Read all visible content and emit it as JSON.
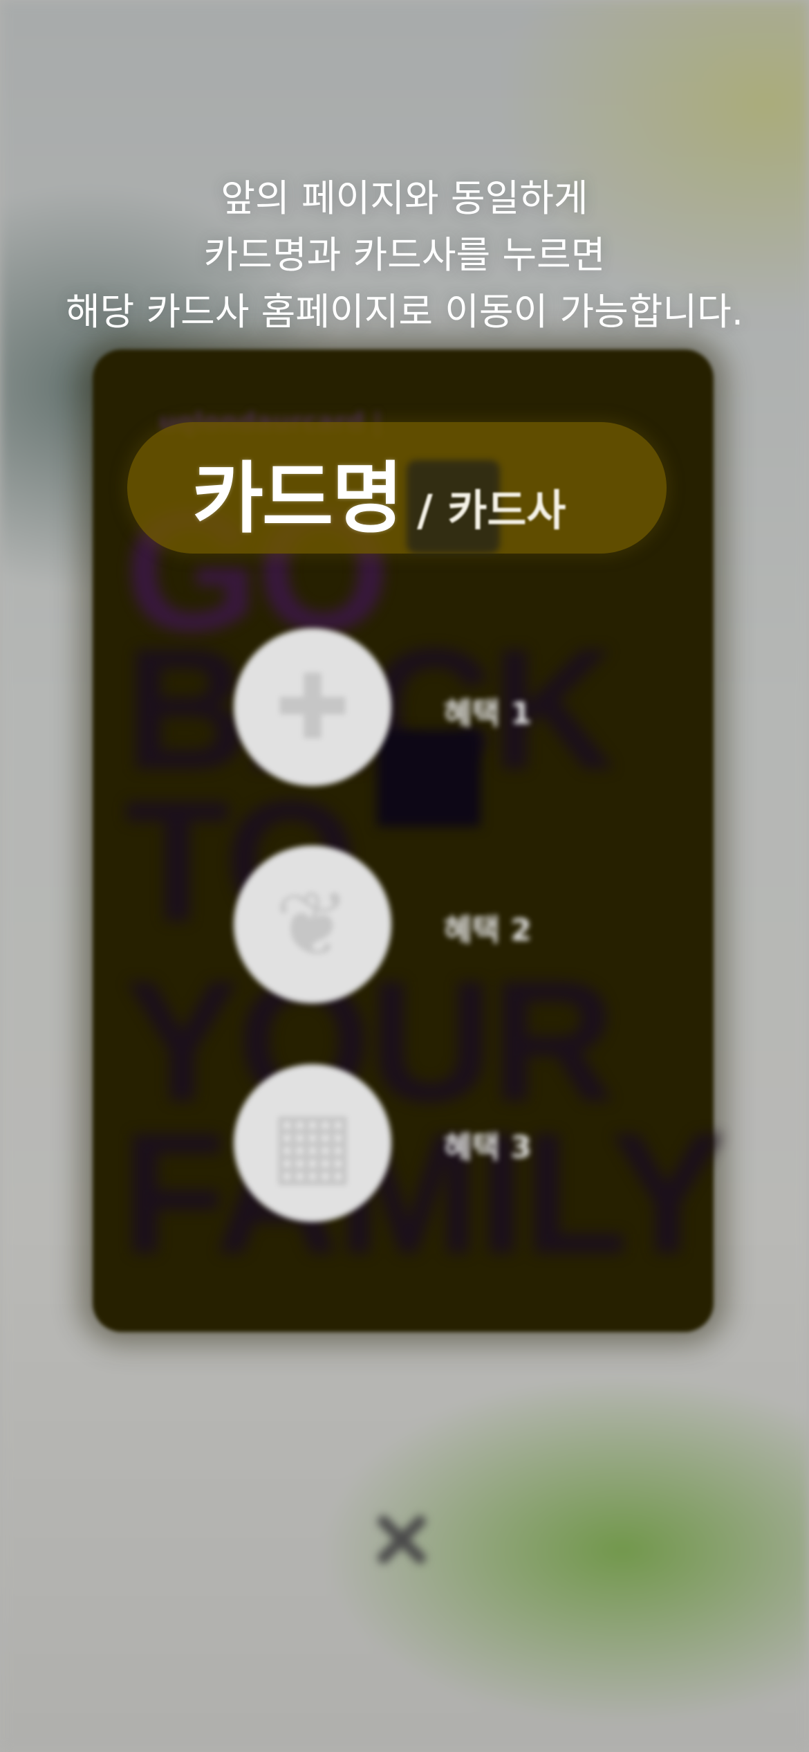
{
  "guide": {
    "line1": "앞의 페이지와 동일하게",
    "line2": "카드명과 카드사를 누르면",
    "line3": "해당 카드사 홈페이지로 이동이 가능합니다."
  },
  "card_highlight": {
    "card_name": "카드명",
    "card_company": "/ 카드사"
  },
  "benefits": [
    {
      "label": "혜택 1",
      "icon": "plus-icon"
    },
    {
      "label": "혜택 2",
      "icon": "leaf-icon"
    },
    {
      "label": "혜택 3",
      "icon": "cart-icon"
    }
  ],
  "background_card": {
    "code": "uqlondaurcard |",
    "words": [
      "GO",
      "BACK",
      "TO",
      "YOUR",
      "FAMILY"
    ]
  },
  "close": {
    "icon": "close-icon"
  },
  "colors": {
    "card_bg": "#262000",
    "pill_bg": "#6e5800",
    "benefit_circle": "#e1e1e1",
    "accent_green": "#6e9646"
  }
}
